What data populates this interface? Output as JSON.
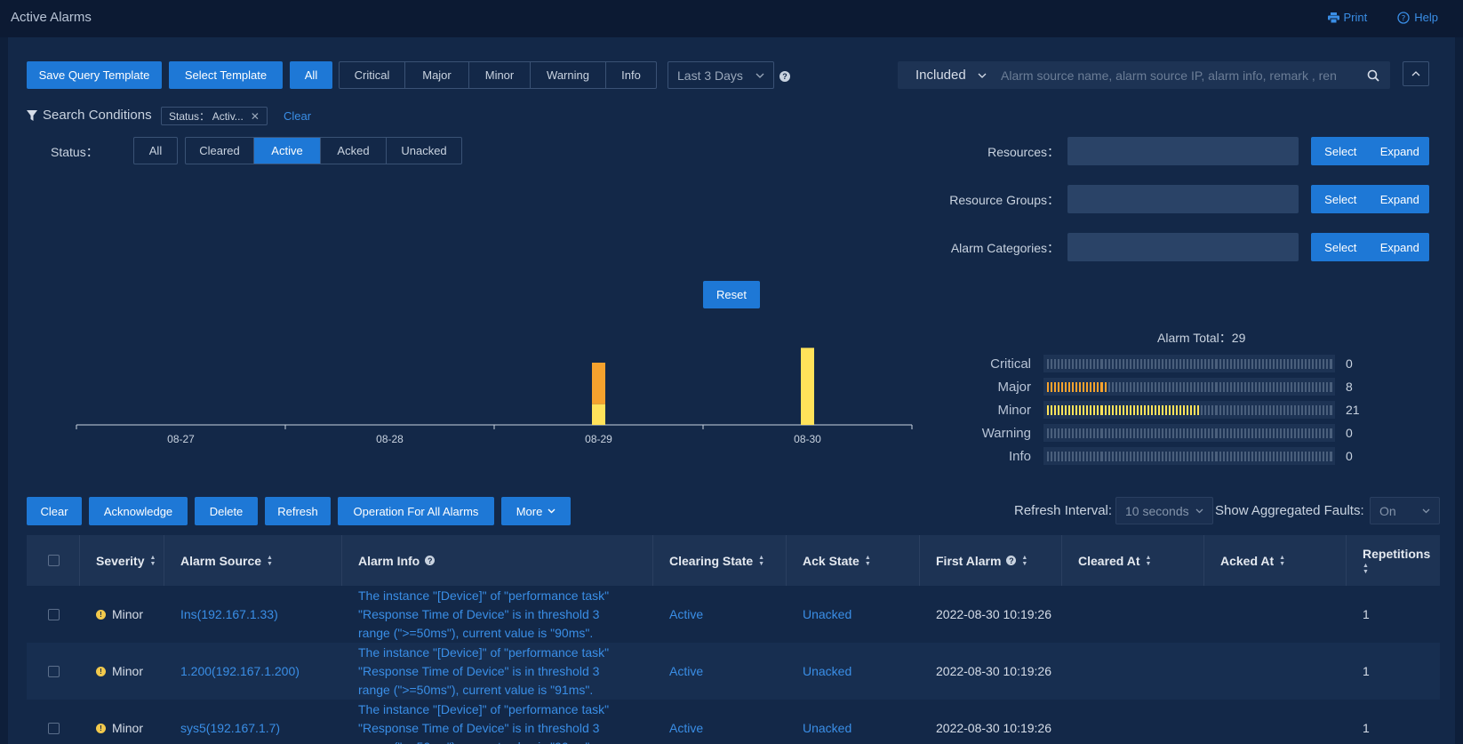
{
  "header": {
    "title": "Active Alarms",
    "print": "Print",
    "help": "Help"
  },
  "toolbar": {
    "save_template": "Save Query Template",
    "select_template": "Select Template",
    "severity_all": "All",
    "severities": [
      "Critical",
      "Major",
      "Minor",
      "Warning",
      "Info"
    ],
    "time_range": "Last 3 Days",
    "search_mode": "Included",
    "search_placeholder": "Alarm source name, alarm source IP, alarm info, remark , ren"
  },
  "conditions": {
    "title": "Search Conditions",
    "tag": "Status： Activ...",
    "clear": "Clear",
    "status_label": "Status：",
    "status_all": "All",
    "status_options": [
      "Cleared",
      "Active",
      "Acked",
      "Unacked"
    ],
    "status_active": "Active",
    "resources_label": "Resources：",
    "resource_groups_label": "Resource Groups：",
    "alarm_categories_label": "Alarm Categories：",
    "select": "Select",
    "expand": "Expand"
  },
  "chart_controls": {
    "reset": "Reset"
  },
  "chart_data": {
    "type": "bar",
    "stacked": true,
    "categories": [
      "08-27",
      "08-28",
      "08-29",
      "08-30"
    ],
    "series": [
      {
        "name": "Minor",
        "color": "#ffe25a",
        "values": [
          0,
          0,
          7,
          26
        ]
      },
      {
        "name": "Major",
        "color": "#f5a22e",
        "values": [
          0,
          0,
          14,
          0
        ]
      }
    ],
    "ylim": [
      0,
      30
    ],
    "grid": false
  },
  "summary": {
    "total_label": "Alarm Total：",
    "total": "29",
    "rows": [
      {
        "name": "Critical",
        "count": "0",
        "fraction": 0,
        "color": "#e5484d"
      },
      {
        "name": "Major",
        "count": "8",
        "fraction": 0.276,
        "color": "#f5a22e"
      },
      {
        "name": "Minor",
        "count": "21",
        "fraction": 0.724,
        "color": "#ffe25a"
      },
      {
        "name": "Warning",
        "count": "0",
        "fraction": 0,
        "color": "#4aa3ff"
      },
      {
        "name": "Info",
        "count": "0",
        "fraction": 0,
        "color": "#4aa3ff"
      }
    ]
  },
  "actions": {
    "clear": "Clear",
    "acknowledge": "Acknowledge",
    "delete": "Delete",
    "refresh": "Refresh",
    "operation_all": "Operation For All Alarms",
    "more": "More",
    "refresh_interval_label": "Refresh Interval:",
    "refresh_interval": "10 seconds",
    "aggregated_label": "Show Aggregated Faults:",
    "aggregated": "On"
  },
  "table": {
    "columns": [
      "Severity",
      "Alarm Source",
      "Alarm Info",
      "Clearing State",
      "Ack State",
      "First Alarm",
      "Cleared At",
      "Acked At",
      "Repetitions"
    ],
    "rows": [
      {
        "severity": "Minor",
        "source": "Ins(192.167.1.33)",
        "info": [
          "The instance \"[Device]\" of \"performance task\"",
          "\"Response Time of Device\" is in threshold 3",
          "range (\">=50ms\"), current value is \"90ms\"."
        ],
        "clearing": "Active",
        "ack": "Unacked",
        "first": "2022-08-30 10:19:26",
        "cleared": "",
        "acked": "",
        "reps": "1"
      },
      {
        "severity": "Minor",
        "source": "1.200(192.167.1.200)",
        "info": [
          "The instance \"[Device]\" of \"performance task\"",
          "\"Response Time of Device\" is in threshold 3",
          "range (\">=50ms\"), current value is \"91ms\"."
        ],
        "clearing": "Active",
        "ack": "Unacked",
        "first": "2022-08-30 10:19:26",
        "cleared": "",
        "acked": "",
        "reps": "1"
      },
      {
        "severity": "Minor",
        "source": "sys5(192.167.1.7)",
        "info": [
          "The instance \"[Device]\" of \"performance task\"",
          "\"Response Time of Device\" is in threshold 3",
          "range (\">=50ms\"), current value is \"90ms\"."
        ],
        "clearing": "Active",
        "ack": "Unacked",
        "first": "2022-08-30 10:19:26",
        "cleared": "",
        "acked": "",
        "reps": "1"
      }
    ]
  }
}
